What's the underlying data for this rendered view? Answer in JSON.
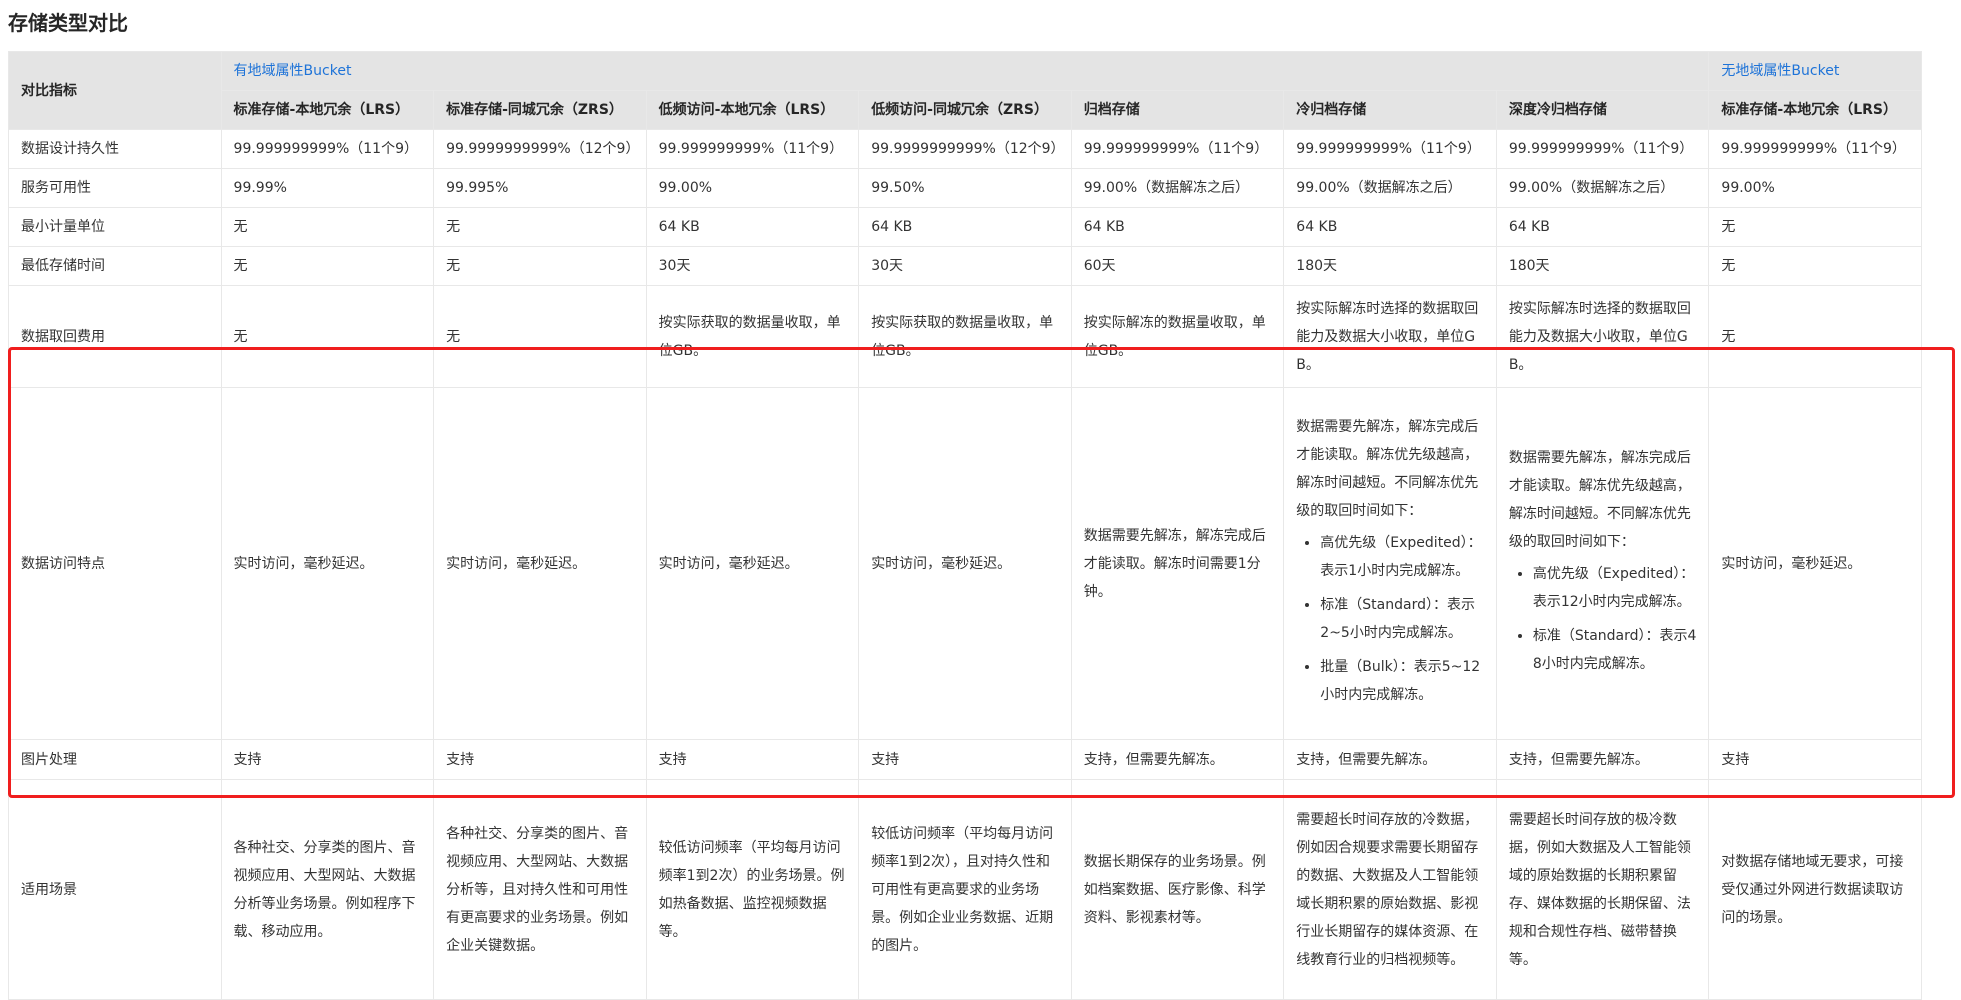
{
  "title": "存储类型对比",
  "header": {
    "metric_label": "对比指标",
    "groups": [
      "有地域属性Bucket",
      "无地域属性Bucket"
    ],
    "columns": [
      "标准存储-本地冗余（LRS）",
      "标准存储-同城冗余（ZRS）",
      "低频访问-本地冗余（LRS）",
      "低频访问-同城冗余（ZRS）",
      "归档存储",
      "冷归档存储",
      "深度冷归档存储",
      "标准存储-本地冗余（LRS）"
    ]
  },
  "rows": {
    "durability": {
      "label": "数据设计持久性",
      "cells": [
        "99.999999999%（11个9）",
        "99.9999999999%（12个9）",
        "99.999999999%（11个9）",
        "99.9999999999%（12个9）",
        "99.999999999%（11个9）",
        "99.999999999%（11个9）",
        "99.999999999%（11个9）",
        "99.999999999%（11个9）"
      ]
    },
    "availability": {
      "label": "服务可用性",
      "cells": [
        "99.99%",
        "99.995%",
        "99.00%",
        "99.50%",
        "99.00%（数据解冻之后）",
        "99.00%（数据解冻之后）",
        "99.00%（数据解冻之后）",
        "99.00%"
      ]
    },
    "min_unit": {
      "label": "最小计量单位",
      "cells": [
        "无",
        "无",
        "64 KB",
        "64 KB",
        "64 KB",
        "64 KB",
        "64 KB",
        "无"
      ]
    },
    "min_time": {
      "label": "最低存储时间",
      "cells": [
        "无",
        "无",
        "30天",
        "30天",
        "60天",
        "180天",
        "180天",
        "无"
      ]
    },
    "retrieval_fee": {
      "label": "数据取回费用",
      "cells": [
        "无",
        "无",
        "按实际获取的数据量收取，单位GB。",
        "按实际获取的数据量收取，单位GB。",
        "按实际解冻的数据量收取，单位GB。",
        "按实际解冻时选择的数据取回能力及数据大小收取，单位GB。",
        "按实际解冻时选择的数据取回能力及数据大小收取，单位GB。",
        "无"
      ]
    },
    "access": {
      "label": "数据访问特点",
      "cells": [
        "实时访问，毫秒延迟。",
        "实时访问，毫秒延迟。",
        "实时访问，毫秒延迟。",
        "实时访问，毫秒延迟。",
        "数据需要先解冻，解冻完成后才能读取。解冻时间需要1分钟。"
      ],
      "cold": {
        "intro": "数据需要先解冻，解冻完成后才能读取。解冻优先级越高，解冻时间越短。不同解冻优先级的取回时间如下：",
        "items": [
          "高优先级（Expedited）：表示1小时内完成解冻。",
          "标准（Standard）：表示2~5小时内完成解冻。",
          "批量（Bulk）：表示5~12小时内完成解冻。"
        ]
      },
      "deep": {
        "intro": "数据需要先解冻，解冻完成后才能读取。解冻优先级越高，解冻时间越短。不同解冻优先级的取回时间如下：",
        "items": [
          "高优先级（Expedited）：表示12小时内完成解冻。",
          "标准（Standard）：表示48小时内完成解冻。"
        ]
      },
      "last": "实时访问，毫秒延迟。"
    },
    "image": {
      "label": "图片处理",
      "cells": [
        "支持",
        "支持",
        "支持",
        "支持",
        "支持，但需要先解冻。",
        "支持，但需要先解冻。",
        "支持，但需要先解冻。",
        "支持"
      ]
    },
    "scenario": {
      "label": "适用场景",
      "cells": [
        "各种社交、分享类的图片、音视频应用、大型网站、大数据分析等业务场景。例如程序下载、移动应用。",
        "各种社交、分享类的图片、音视频应用、大型网站、大数据分析等，且对持久性和可用性有更高要求的业务场景。例如企业关键数据。",
        "较低访问频率（平均每月访问频率1到2次）的业务场景。例如热备数据、监控视频数据等。",
        "较低访问频率（平均每月访问频率1到2次），且对持久性和可用性有更高要求的业务场景。例如企业业务数据、近期的图片。",
        "数据长期保存的业务场景。例如档案数据、医疗影像、科学资料、影视素材等。",
        "需要超长时间存放的冷数据，例如因合规要求需要长期留存的数据、大数据及人工智能领域长期积累的原始数据、影视行业长期留存的媒体资源、在线教育行业的归档视频等。",
        "需要超长时间存放的极冷数据，例如大数据及人工智能领域的原始数据的长期积累留存、媒体数据的长期保留、法规和合规性存档、磁带替换等。",
        "对数据存储地域无要求，可接受仅通过外网进行数据读取访问的场景。"
      ]
    }
  }
}
